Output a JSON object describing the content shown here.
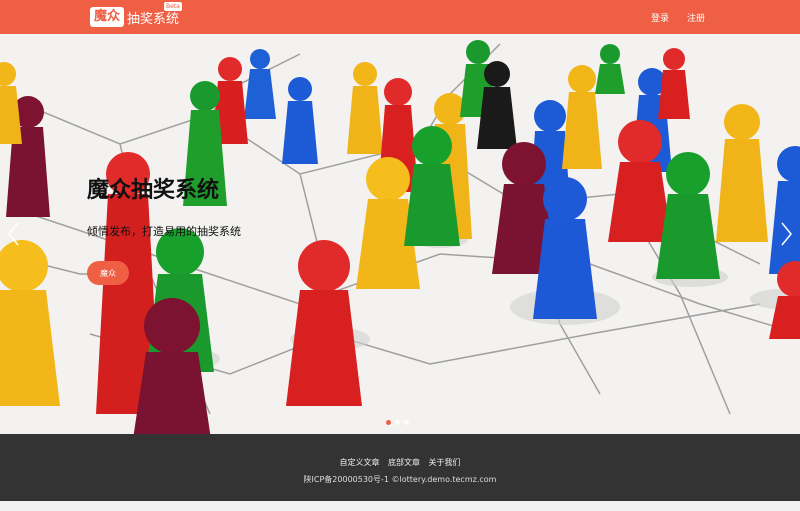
{
  "navbar": {
    "logo_box": "魔众",
    "logo_text": "抽奖系统",
    "logo_badge": "Beta",
    "links": [
      "登录",
      "注册"
    ]
  },
  "hero": {
    "title": "魔众抽奖系统",
    "subtitle": "倾情发布，打造易用的抽奖系统",
    "button_label": "魔众",
    "slide_count": 3,
    "active_slide": 1,
    "image_description": "colored board game pawns connected by lines"
  },
  "footer": {
    "links": [
      "自定义文章",
      "底部文章",
      "关于我们"
    ],
    "copyright": "陕ICP备20000530号-1 ©lottery.demo.tecmz.com"
  },
  "colors": {
    "brand": "#ef5f44",
    "footer_bg": "#333333"
  },
  "icons": {
    "prev": "chevron-left-icon",
    "next": "chevron-right-icon"
  }
}
